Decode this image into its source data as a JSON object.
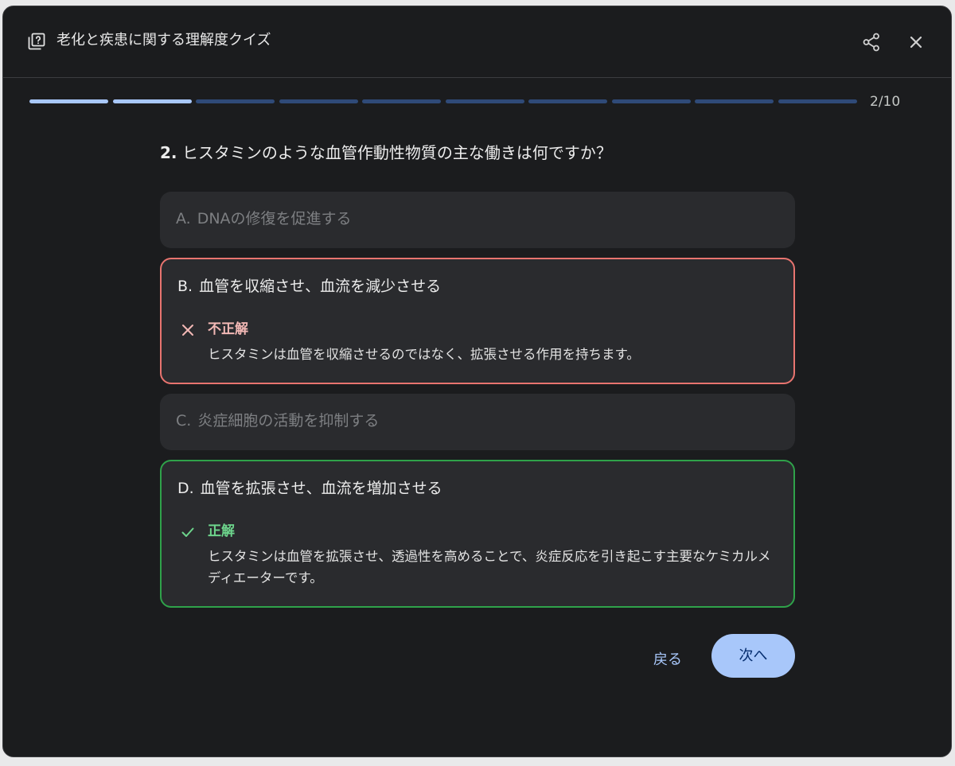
{
  "header": {
    "title": "老化と疾患に関する理解度クイズ",
    "quiz_icon": "quiz-icon",
    "share_icon": "share-icon",
    "close_icon": "close-icon"
  },
  "progress": {
    "current": 2,
    "total": 10,
    "label": "2/10",
    "completed_color": "#a8c7fa",
    "remaining_color": "#2f4a78"
  },
  "question": {
    "number": "2.",
    "text": "ヒスタミンのような血管作動性物質の主な働きは何ですか？"
  },
  "options": [
    {
      "letter": "A.",
      "text": "DNAの修復を促進する",
      "state": "dim"
    },
    {
      "letter": "B.",
      "text": "血管を収縮させ、血流を減少させる",
      "state": "incorrect",
      "feedback_title": "不正解",
      "feedback_text": "ヒスタミンは血管を収縮させるのではなく、拡張させる作用を持ちます。",
      "icon": "x-icon"
    },
    {
      "letter": "C.",
      "text": "炎症細胞の活動を抑制する",
      "state": "dim"
    },
    {
      "letter": "D.",
      "text": "血管を拡張させ、血流を増加させる",
      "state": "correct",
      "feedback_title": "正解",
      "feedback_text": "ヒスタミンは血管を拡張させ、透過性を高めることで、炎症反応を引き起こす主要なケミカルメディエーターです。",
      "icon": "check-icon"
    }
  ],
  "nav": {
    "back_label": "戻る",
    "next_label": "次へ"
  },
  "colors": {
    "incorrect_border": "#e8746f",
    "correct_border": "#2fa24a",
    "accent": "#a8c7fa"
  }
}
